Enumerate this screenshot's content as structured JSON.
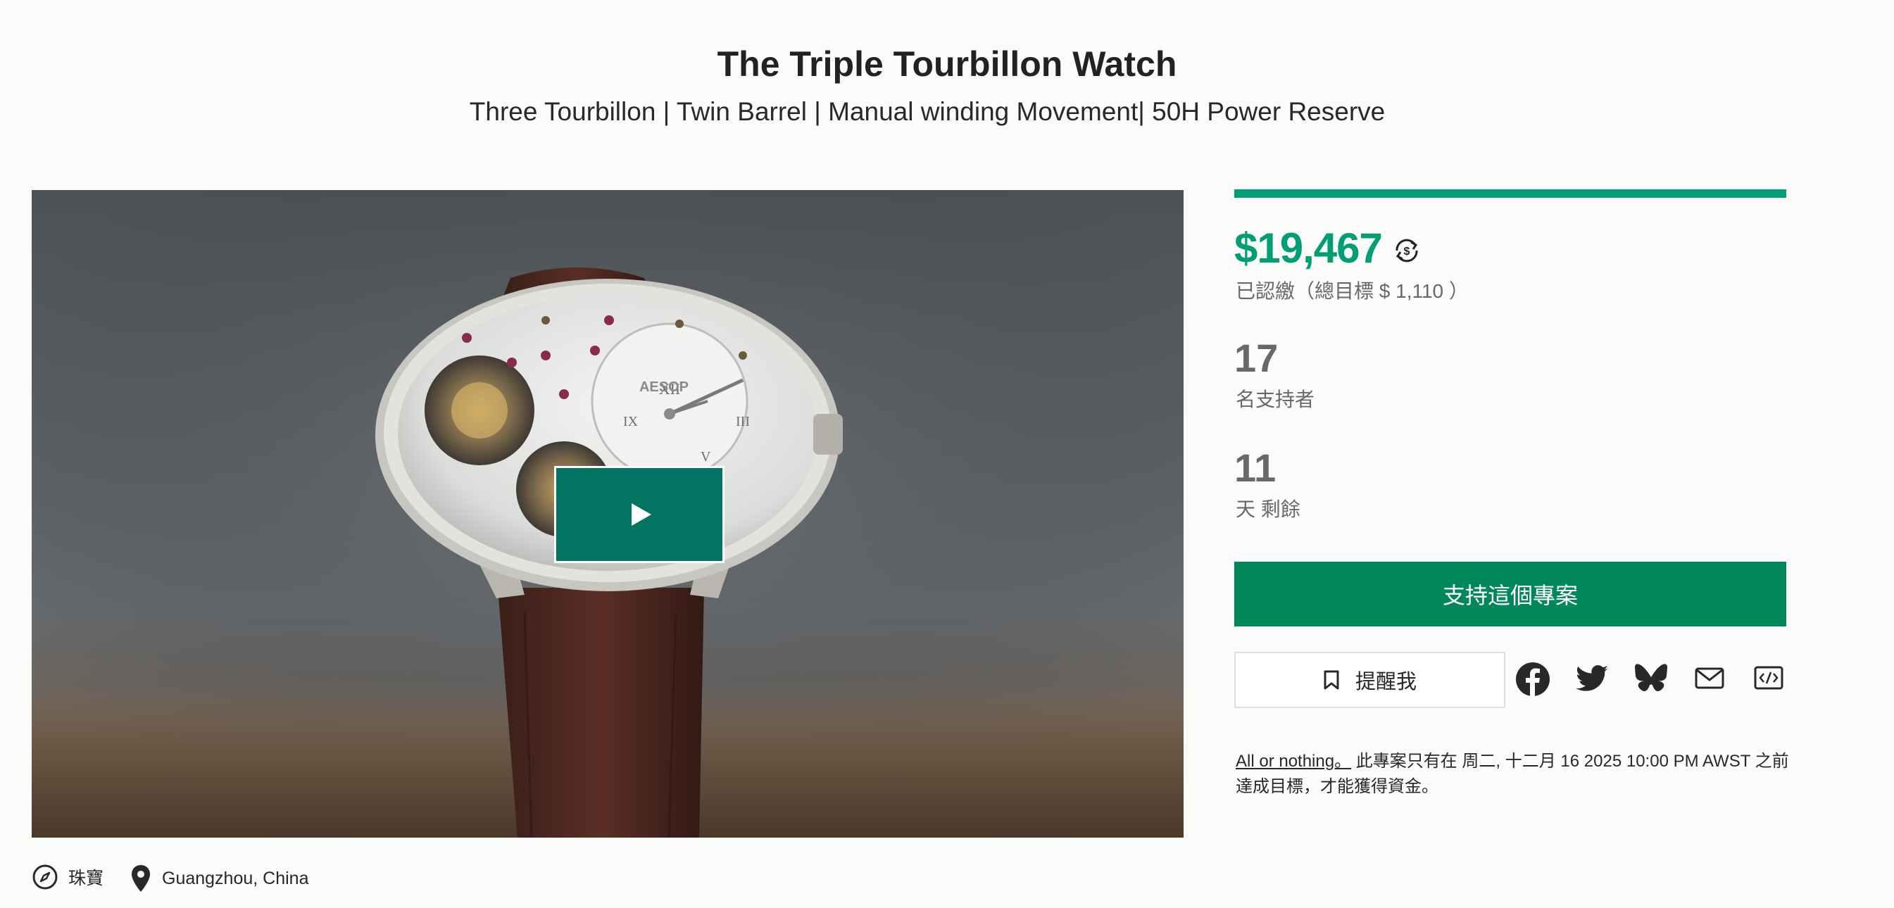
{
  "project": {
    "title": "The Triple Tourbillon Watch",
    "subtitle": "Three Tourbillon | Twin Barrel | Manual winding Movement| 50H Power Reserve"
  },
  "media": {
    "play_icon": "play-icon",
    "watch_brand": "AESOP"
  },
  "stats": {
    "progress_fraction": 1.0,
    "pledged": "$19,467",
    "pledged_label": "已認繳（總目標 $ 1,110 ）",
    "currency_icon": "currency-exchange-icon",
    "backers": "17",
    "backers_label": "名支持者",
    "days": "11",
    "days_label": "天 剩餘"
  },
  "actions": {
    "back_label": "支持這個專案",
    "remind_label": "提醒我",
    "remind_icon": "bookmark-icon",
    "share_icons": [
      "facebook-icon",
      "twitter-icon",
      "bluesky-icon",
      "mail-icon",
      "embed-icon"
    ]
  },
  "terms": {
    "link_label": "All or nothing。",
    "text": "此專案只有在 周二, 十二月 16 2025 10:00 PM AWST 之前達成目標，才能獲得資金。"
  },
  "footer": {
    "category": "珠寶",
    "category_icon": "compass-icon",
    "location": "Guangzhou, China",
    "location_icon": "location-pin-icon"
  },
  "colors": {
    "accent": "#009e74",
    "button": "#028858",
    "play_button": "#037362",
    "muted_text": "#656969"
  }
}
